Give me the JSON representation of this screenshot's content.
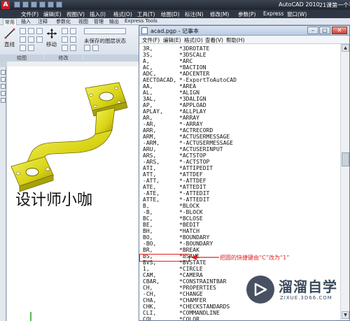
{
  "acad": {
    "title": "AutoCAD 2010",
    "title_extra": "21课第一个平",
    "menu": [
      "文件(F)",
      "编辑(E)",
      "视图(V)",
      "插入(I)",
      "格式(O)",
      "工具(T)",
      "绘图(D)",
      "标注(N)",
      "修改(M)",
      "参数(P)",
      "Express",
      "窗口(W)"
    ],
    "ribbon_tabs": [
      "常用",
      "插入",
      "注释",
      "参数化",
      "视图",
      "管理",
      "输出",
      "Express Tools"
    ],
    "ribbon": {
      "line_label": "直线",
      "move_label": "移动",
      "layer_state": "未保存的图层状态",
      "draw_panel": "绘图",
      "modify_panel": "修改"
    }
  },
  "drawing": {
    "overlay_text": "设计师小咖"
  },
  "notepad": {
    "title": "acad.pgp - 记事本",
    "menu": [
      "文件(F)",
      "编辑(E)",
      "格式(O)",
      "查看(V)",
      "帮助(H)"
    ],
    "lines": [
      [
        "3R,",
        "*3DROTATE"
      ],
      [
        "3S,",
        "*3DSCALE"
      ],
      [
        "A,",
        "*ARC"
      ],
      [
        "AC,",
        "*BACTION"
      ],
      [
        "ADC,",
        "*ADCENTER"
      ],
      [
        "AECTOACAD,",
        "*-ExportToAutoCAD"
      ],
      [
        "AA,",
        "*AREA"
      ],
      [
        "AL,",
        "*ALIGN"
      ],
      [
        "3AL,",
        "*3DALIGN"
      ],
      [
        "AP,",
        "*APPLOAD"
      ],
      [
        "APLAY,",
        "*ALLPLAY"
      ],
      [
        "AR,",
        "*ARRAY"
      ],
      [
        "-AR,",
        "*-ARRAY"
      ],
      [
        "ARR,",
        "*ACTRECORD"
      ],
      [
        "ARM,",
        "*ACTUSERMESSAGE"
      ],
      [
        "-ARM,",
        "*-ACTUSERMESSAGE"
      ],
      [
        "ARU,",
        "*ACTUSERINPUT"
      ],
      [
        "ARS,",
        "*ACTSTOP"
      ],
      [
        "-ARS,",
        "*-ACTSTOP"
      ],
      [
        "ATI,",
        "*ATTIPEDIT"
      ],
      [
        "ATT,",
        "*ATTDEF"
      ],
      [
        "-ATT,",
        "*-ATTDEF"
      ],
      [
        "ATE,",
        "*ATTEDIT"
      ],
      [
        "-ATE,",
        "*-ATTEDIT"
      ],
      [
        "ATTE,",
        "*-ATTEDIT"
      ],
      [
        "B,",
        "*BLOCK"
      ],
      [
        "-B,",
        "*-BLOCK"
      ],
      [
        "BC,",
        "*BCLOSE"
      ],
      [
        "BE,",
        "*BEDIT"
      ],
      [
        "BH,",
        "*HATCH"
      ],
      [
        "BO,",
        "*BOUNDARY"
      ],
      [
        "-BO,",
        "*-BOUNDARY"
      ],
      [
        "BR,",
        "*BREAK"
      ],
      [
        "BS,",
        "*BSAVE"
      ],
      [
        "BVS,",
        "*BVSTATE"
      ],
      [
        "1,",
        "*CIRCLE"
      ],
      [
        "CAM,",
        "*CAMERA"
      ],
      [
        "CBAR,",
        "*CONSTRAINTBAR"
      ],
      [
        "CH,",
        "*PROPERTIES"
      ],
      [
        "-CH,",
        "*CHANGE"
      ],
      [
        "CHA,",
        "*CHAMFER"
      ],
      [
        "CHK,",
        "*CHECKSTANDARDS"
      ],
      [
        "CLI,",
        "*COMMANDLINE"
      ],
      [
        "COL,",
        "*COLOR"
      ],
      [
        "COLOUR,",
        "*COLOR"
      ]
    ]
  },
  "annotation": {
    "text": "把圆的快捷键由“C”改为“1”"
  },
  "brand": {
    "name": "溜溜自学",
    "url": "ZIXUE.3D66.COM"
  }
}
